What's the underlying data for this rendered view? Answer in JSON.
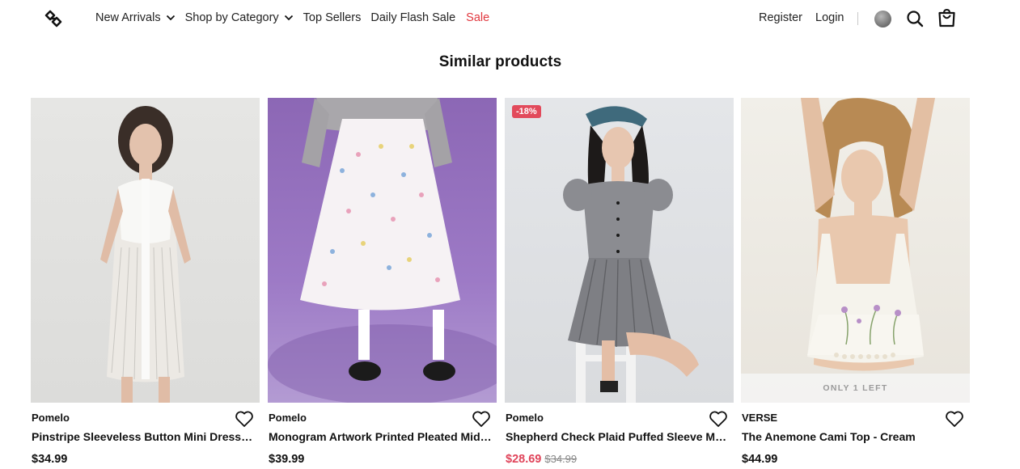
{
  "header": {
    "nav": [
      {
        "label": "New Arrivals",
        "has_dropdown": true
      },
      {
        "label": "Shop by Category",
        "has_dropdown": true
      },
      {
        "label": "Top Sellers",
        "has_dropdown": false
      },
      {
        "label": "Daily Flash Sale",
        "has_dropdown": false
      },
      {
        "label": "Sale",
        "has_dropdown": false
      }
    ],
    "register_label": "Register",
    "login_label": "Login",
    "icons": [
      "logo-icon",
      "globe-icon",
      "search-icon",
      "shopping-bag-icon"
    ]
  },
  "section": {
    "title": "Similar products"
  },
  "products": [
    {
      "brand": "Pomelo",
      "name": "Pinstripe Sleeveless Button Mini Dress - ...",
      "price": "$34.99",
      "old_price": "",
      "badge": "",
      "stock_note": ""
    },
    {
      "brand": "Pomelo",
      "name": "Monogram Artwork Printed Pleated Midi ...",
      "price": "$39.99",
      "old_price": "",
      "badge": "",
      "stock_note": ""
    },
    {
      "brand": "Pomelo",
      "name": "Shepherd Check Plaid Puffed Sleeve Mini...",
      "price": "$28.69",
      "old_price": "$34.99",
      "badge": "-18%",
      "stock_note": ""
    },
    {
      "brand": "VERSE",
      "name": "The Anemone Cami Top - Cream",
      "price": "$44.99",
      "old_price": "",
      "badge": "",
      "stock_note": "ONLY 1 LEFT"
    }
  ],
  "colors": {
    "sale_red": "#e1373e",
    "badge_red": "#e24a5b",
    "sale_price": "#e0445a",
    "text": "#111111"
  }
}
